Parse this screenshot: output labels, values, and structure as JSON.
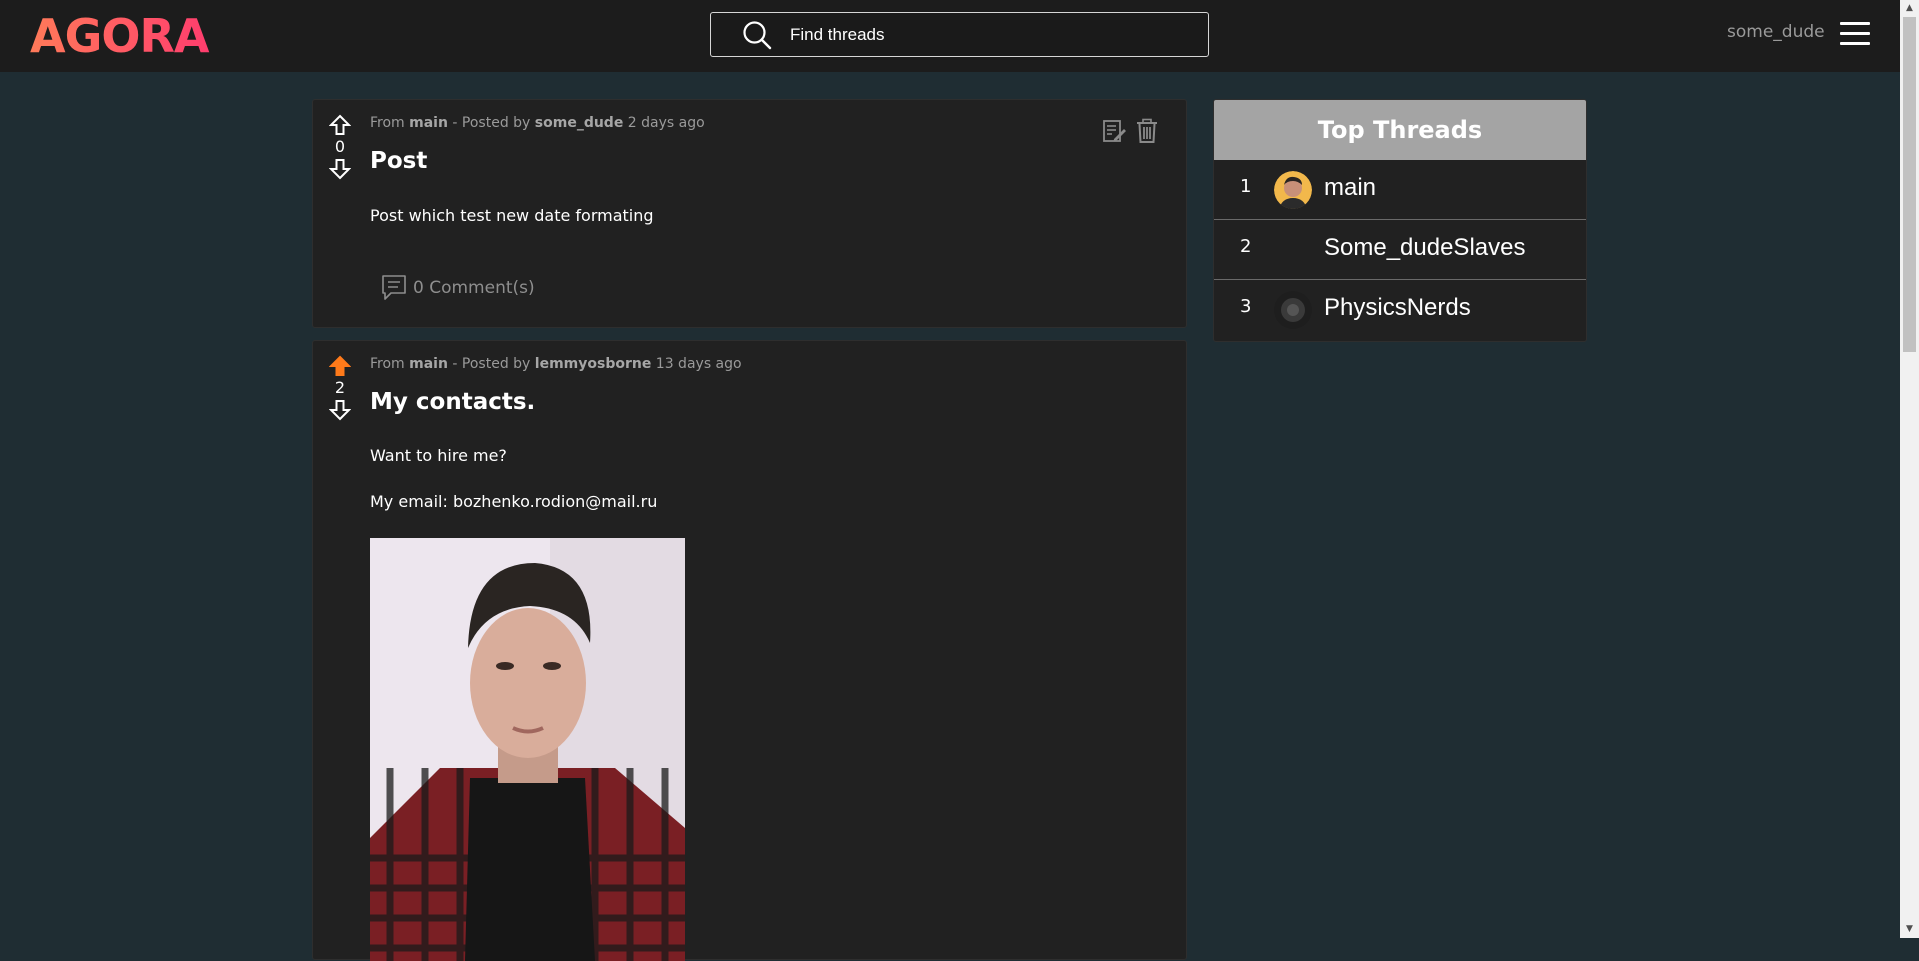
{
  "header": {
    "logo": "AGORA",
    "search_placeholder": "Find threads",
    "username": "some_dude"
  },
  "posts": [
    {
      "thread": "main",
      "author": "some_dude",
      "age": "2 days ago",
      "from_label": "From",
      "posted_by_label": "- Posted by",
      "votes": "0",
      "title": "Post",
      "body": [
        "Post which test new date formating"
      ],
      "comments": "0 Comment(s)",
      "upvoted": false
    },
    {
      "thread": "main",
      "author": "lemmyosborne",
      "age": "13 days ago",
      "from_label": "From",
      "posted_by_label": "- Posted by",
      "votes": "2",
      "title": "My contacts.",
      "body": [
        "Want to hire me?",
        "My email: bozhenko.rodion@mail.ru"
      ],
      "upvoted": true
    }
  ],
  "top_threads": {
    "title": "Top Threads",
    "items": [
      {
        "rank": "1",
        "name": "main"
      },
      {
        "rank": "2",
        "name": "Some_dudeSlaves"
      },
      {
        "rank": "3",
        "name": "PhysicsNerds"
      }
    ]
  },
  "colors": {
    "accent": "#ff5f6d",
    "upvote_active": "#ff7a1a",
    "background": "#1f2d33",
    "card": "#212121"
  }
}
